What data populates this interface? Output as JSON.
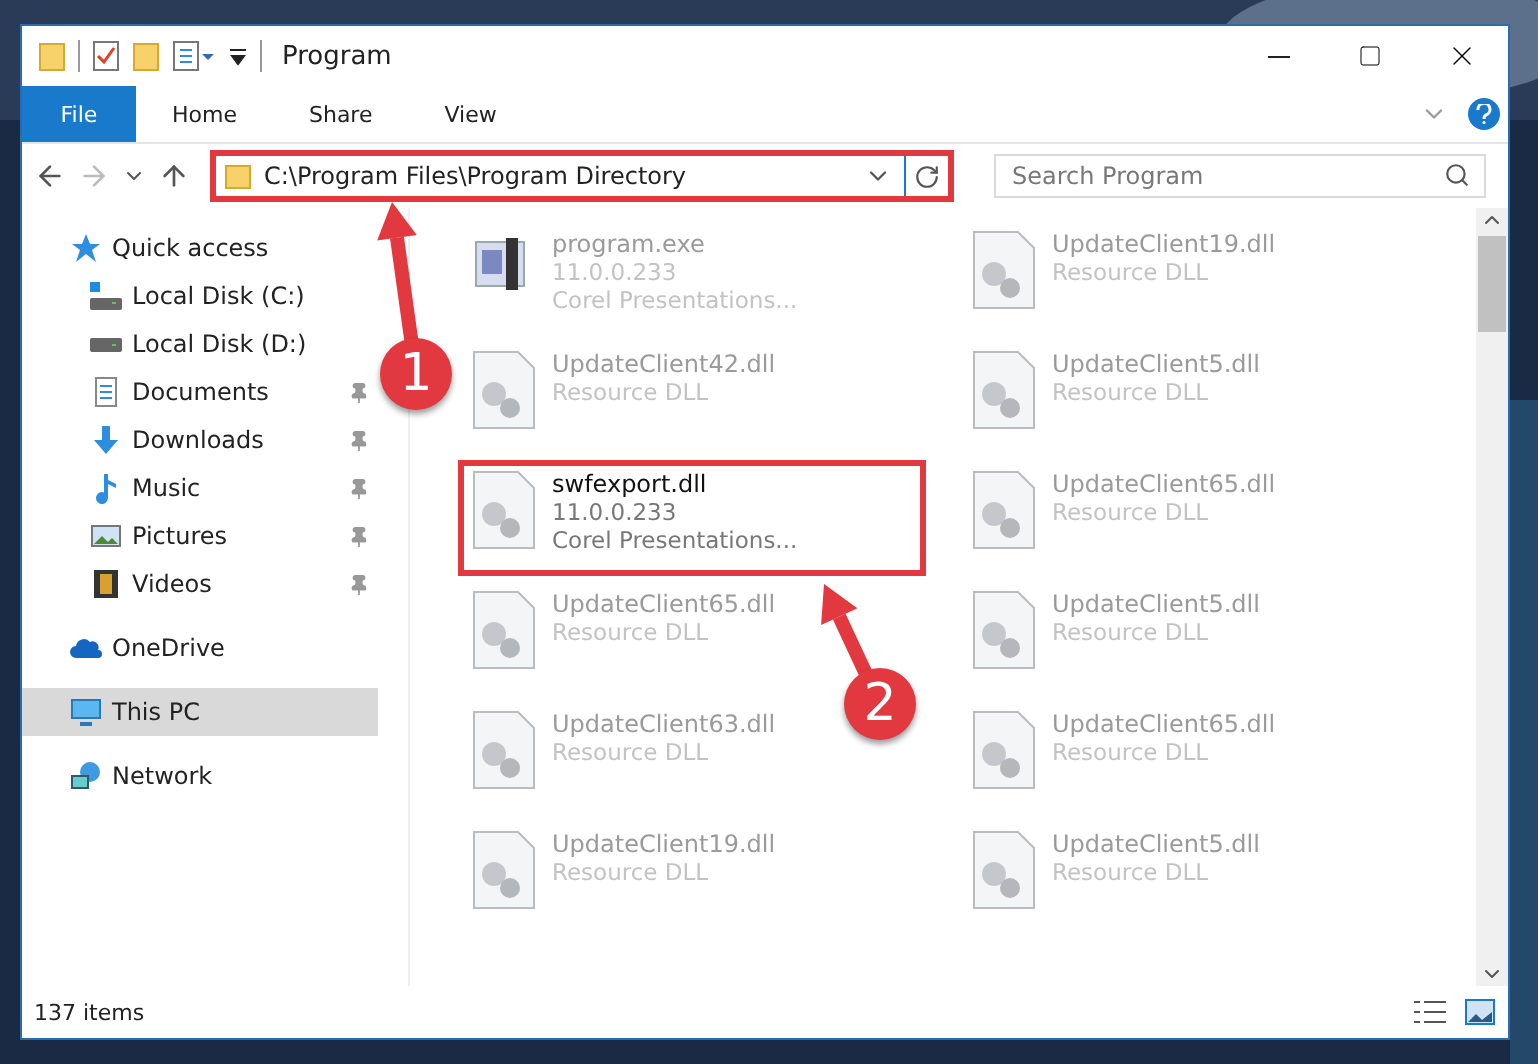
{
  "window": {
    "title": "Program"
  },
  "ribbon": {
    "tabs": [
      {
        "label": "File",
        "selected": true
      },
      {
        "label": "Home",
        "selected": false
      },
      {
        "label": "Share",
        "selected": false
      },
      {
        "label": "View",
        "selected": false
      }
    ]
  },
  "address_bar": {
    "path": "C:\\Program Files\\Program Directory",
    "highlighted": true
  },
  "search": {
    "placeholder": "Search Program"
  },
  "navigation": [
    {
      "label": "Quick access",
      "kind": "star",
      "selected": false,
      "children": [
        {
          "label": "Local Disk (C:)",
          "kind": "system-drive",
          "pinned": false,
          "selected": false
        },
        {
          "label": "Local Disk (D:)",
          "kind": "drive",
          "pinned": false,
          "selected": false
        },
        {
          "label": "Documents",
          "kind": "documents",
          "pinned": true,
          "selected": false
        },
        {
          "label": "Downloads",
          "kind": "downloads",
          "pinned": true,
          "selected": false
        },
        {
          "label": "Music",
          "kind": "music",
          "pinned": true,
          "selected": false
        },
        {
          "label": "Pictures",
          "kind": "pictures",
          "pinned": true,
          "selected": false
        },
        {
          "label": "Videos",
          "kind": "videos",
          "pinned": true,
          "selected": false
        }
      ]
    },
    {
      "label": "OneDrive",
      "kind": "cloud",
      "selected": false
    },
    {
      "label": "This PC",
      "kind": "computer",
      "selected": true
    },
    {
      "label": "Network",
      "kind": "network",
      "selected": false
    }
  ],
  "files": [
    {
      "name": "program.exe",
      "details": [
        "11.0.0.233",
        "Corel Presentations..."
      ],
      "kind": "exe",
      "highlighted": false
    },
    {
      "name": "UpdateClient19.dll",
      "details": [
        "Resource DLL"
      ],
      "kind": "dll",
      "highlighted": false
    },
    {
      "name": "UpdateClient42.dll",
      "details": [
        "Resource DLL"
      ],
      "kind": "dll",
      "highlighted": false
    },
    {
      "name": "UpdateClient5.dll",
      "details": [
        "Resource DLL"
      ],
      "kind": "dll",
      "highlighted": false
    },
    {
      "name": "swfexport.dll",
      "details": [
        "11.0.0.233",
        "Corel Presentations..."
      ],
      "kind": "dll",
      "highlighted": true
    },
    {
      "name": "UpdateClient65.dll",
      "details": [
        "Resource DLL"
      ],
      "kind": "dll",
      "highlighted": false
    },
    {
      "name": "UpdateClient65.dll",
      "details": [
        "Resource DLL"
      ],
      "kind": "dll",
      "highlighted": false
    },
    {
      "name": "UpdateClient5.dll",
      "details": [
        "Resource DLL"
      ],
      "kind": "dll",
      "highlighted": false
    },
    {
      "name": "UpdateClient63.dll",
      "details": [
        "Resource DLL"
      ],
      "kind": "dll",
      "highlighted": false
    },
    {
      "name": "UpdateClient65.dll",
      "details": [
        "Resource DLL"
      ],
      "kind": "dll",
      "highlighted": false
    },
    {
      "name": "UpdateClient19.dll",
      "details": [
        "Resource DLL"
      ],
      "kind": "dll",
      "highlighted": false
    },
    {
      "name": "UpdateClient5.dll",
      "details": [
        "Resource DLL"
      ],
      "kind": "dll",
      "highlighted": false
    }
  ],
  "status_bar": {
    "item_count": "137 items"
  },
  "annotations": [
    {
      "number": "1"
    },
    {
      "number": "2"
    }
  ]
}
